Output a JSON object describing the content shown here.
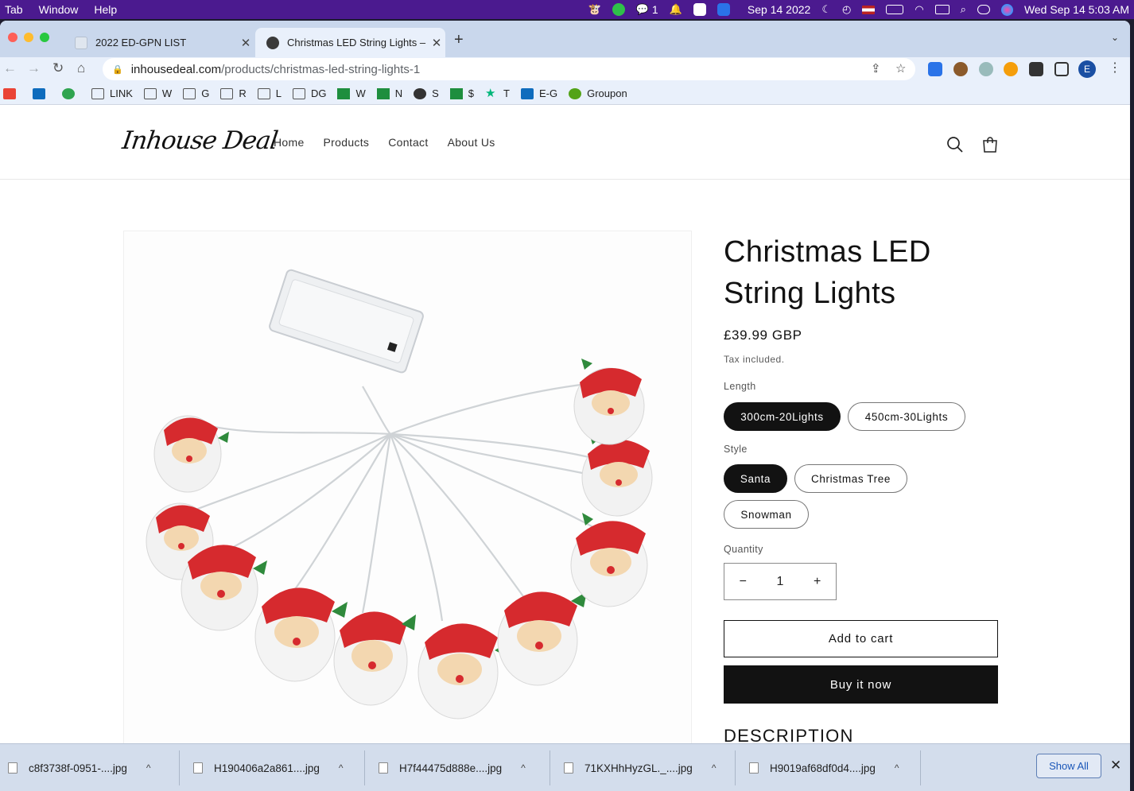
{
  "menubar": {
    "items": [
      "Tab",
      "Window",
      "Help"
    ],
    "date_center": "Sep 14 2022",
    "clock": "Wed Sep 14  5:03 AM",
    "wechat_count": "1"
  },
  "browser": {
    "tabs": [
      {
        "title": "2022 ED-GPN LIST"
      },
      {
        "title": "Christmas LED String Lights – I"
      }
    ],
    "url_host": "inhousedeal.com",
    "url_path": "/products/christmas-led-string-lights-1",
    "profile_initial": "E",
    "bookmarks": [
      "LINK",
      "W",
      "G",
      "R",
      "L",
      "DG",
      "W",
      "N",
      "S",
      "$",
      "T",
      "E-G",
      "Groupon"
    ]
  },
  "site": {
    "logo": "Inhouse Deal",
    "nav": [
      "Home",
      "Products",
      "Contact",
      "About Us"
    ]
  },
  "product": {
    "title": "Christmas LED String Lights",
    "price": "£39.99 GBP",
    "tax": "Tax included.",
    "length_label": "Length",
    "length_options": [
      "300cm-20Lights",
      "450cm-30Lights"
    ],
    "length_selected": "300cm-20Lights",
    "style_label": "Style",
    "style_options": [
      "Santa",
      "Christmas Tree",
      "Snowman"
    ],
    "style_selected": "Santa",
    "quantity_label": "Quantity",
    "quantity": "1",
    "add_to_cart": "Add to cart",
    "buy_now": "Buy it now",
    "description_heading": "DESCRIPTION"
  },
  "downloads": {
    "files": [
      "c8f3738f-0951-....jpg",
      "H190406a2a861....jpg",
      "H7f44475d888e....jpg",
      "71KXHhHyzGL._....jpg",
      "H9019af68df0d4....jpg"
    ],
    "show_all": "Show All"
  },
  "colors": {
    "menubar": "#4b1a8f",
    "tabstrip": "#c9d7ec",
    "toolbar": "#e9f0fb",
    "selected_pill": "#121212",
    "download_bar": "#d3ddec"
  }
}
